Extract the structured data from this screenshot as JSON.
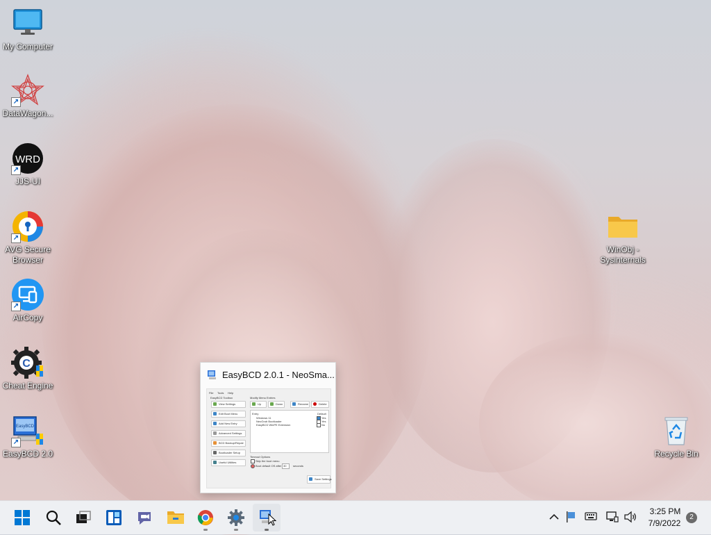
{
  "desktop": {
    "icons": [
      {
        "label": "My Computer",
        "icon": "monitor-icon"
      },
      {
        "label": "DataWagon...",
        "icon": "star-burst-icon"
      },
      {
        "label": "JJS-UI",
        "icon": "wrd-circle-icon"
      },
      {
        "label": "AVG Secure Browser",
        "icon": "avg-browser-icon"
      },
      {
        "label": "AirCopy",
        "icon": "aircopy-icon"
      },
      {
        "label": "Cheat Engine",
        "icon": "cheat-engine-icon"
      },
      {
        "label": "EasyBCD 2.0",
        "icon": "easybcd-icon"
      },
      {
        "label": "WinObj - Sysinternals",
        "icon": "folder-icon"
      },
      {
        "label": "Recycle Bin",
        "icon": "recycle-bin-icon"
      }
    ]
  },
  "thumbnail": {
    "title": "EasyBCD 2.0.1  - NeoSma...",
    "preview": {
      "menu": [
        "File",
        "Tools",
        "Help"
      ],
      "toolbox_heading": "EasyBCD Toolbox",
      "toolbox_buttons": [
        "View Settings",
        "Edit Boot Menu",
        "Add New Entry",
        "Advanced Settings",
        "BCD Backup/Repair",
        "Bootloader Setup",
        "Useful Utilities"
      ],
      "modify_heading": "Modify Menu Entries",
      "modify_buttons": [
        "Up",
        "Down",
        "Rename",
        "Delete"
      ],
      "list_header": "Entry",
      "list_items": [
        "Windows 11",
        "NeoGrub Bootloader",
        "EasyBCD WinPE Extension"
      ],
      "default_header": "Default",
      "default_values": [
        "Yes",
        "Yes",
        "No"
      ],
      "timeout_heading": "Timeout Options",
      "timeout_opt1": "Skip the boot menu",
      "timeout_opt2": "Boot default OS after",
      "timeout_value": "30",
      "timeout_unit": "seconds",
      "save_label": "Save Settings"
    }
  },
  "taskbar": {
    "buttons": [
      {
        "name": "start-button",
        "icon": "windows-logo-icon"
      },
      {
        "name": "search-button",
        "icon": "search-icon"
      },
      {
        "name": "task-view-button",
        "icon": "task-view-icon"
      },
      {
        "name": "widgets-button",
        "icon": "widgets-icon"
      },
      {
        "name": "teams-chat-button",
        "icon": "teams-chat-icon"
      },
      {
        "name": "file-explorer-button",
        "icon": "folder-icon"
      },
      {
        "name": "chrome-button",
        "icon": "chrome-icon"
      },
      {
        "name": "settings-button",
        "icon": "gear-icon"
      },
      {
        "name": "easybcd-taskbar-button",
        "icon": "easybcd-icon"
      }
    ],
    "clock": {
      "time": "3:25 PM",
      "date": "7/9/2022"
    },
    "notification_count": "2"
  },
  "colors": {
    "taskbar_bg": "#eef0f3",
    "windows_blue": "#0078d4",
    "folder_yellow": "#f8c84a"
  }
}
